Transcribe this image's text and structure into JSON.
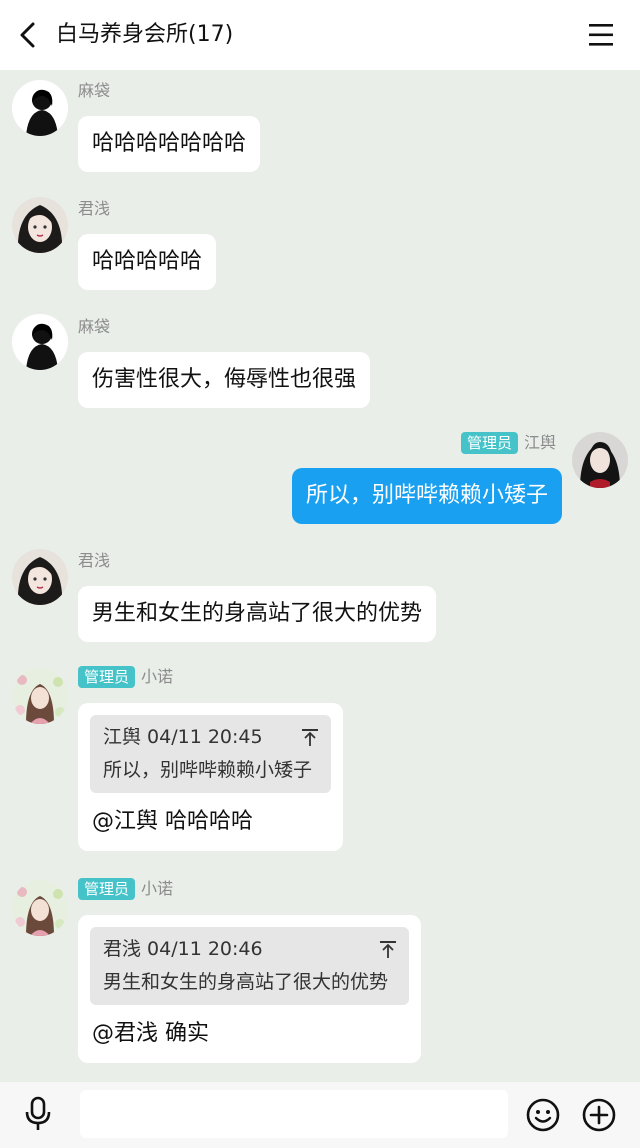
{
  "header": {
    "title": "白马养身会所(17)",
    "back_icon": "chevron-left-icon",
    "menu_icon": "hamburger-menu-icon"
  },
  "messages": [
    {
      "sender": "麻袋",
      "text": "哈哈哈哈哈哈哈"
    },
    {
      "sender": "君浅",
      "text": "哈哈哈哈哈"
    },
    {
      "sender": "麻袋",
      "text": "伤害性很大，侮辱性也很强"
    },
    {
      "sender": "江舆",
      "role": "管理员",
      "text": "所以，别哔哔赖赖小矮子"
    },
    {
      "sender": "君浅",
      "text": "男生和女生的身高站了很大的优势"
    },
    {
      "sender": "小诺",
      "role": "管理员",
      "quote": {
        "author_time": "江舆 04/11 20:45",
        "text": "所以，别哔哔赖赖小矮子"
      },
      "text": "@江舆 哈哈哈哈"
    },
    {
      "sender": "小诺",
      "role": "管理员",
      "quote": {
        "author_time": "君浅 04/11 20:46",
        "text": "男生和女生的身高站了很大的优势"
      },
      "text": "@君浅 确实"
    }
  ],
  "bottom": {
    "mic_icon": "microphone-icon",
    "input_value": "",
    "emoji_icon": "smiley-icon",
    "plus_icon": "plus-circle-icon"
  },
  "colors": {
    "background": "#e9eee9",
    "my_bubble": "#1aa0f0",
    "admin_badge": "#45c3c9",
    "name_gray": "#8c8c8c"
  }
}
